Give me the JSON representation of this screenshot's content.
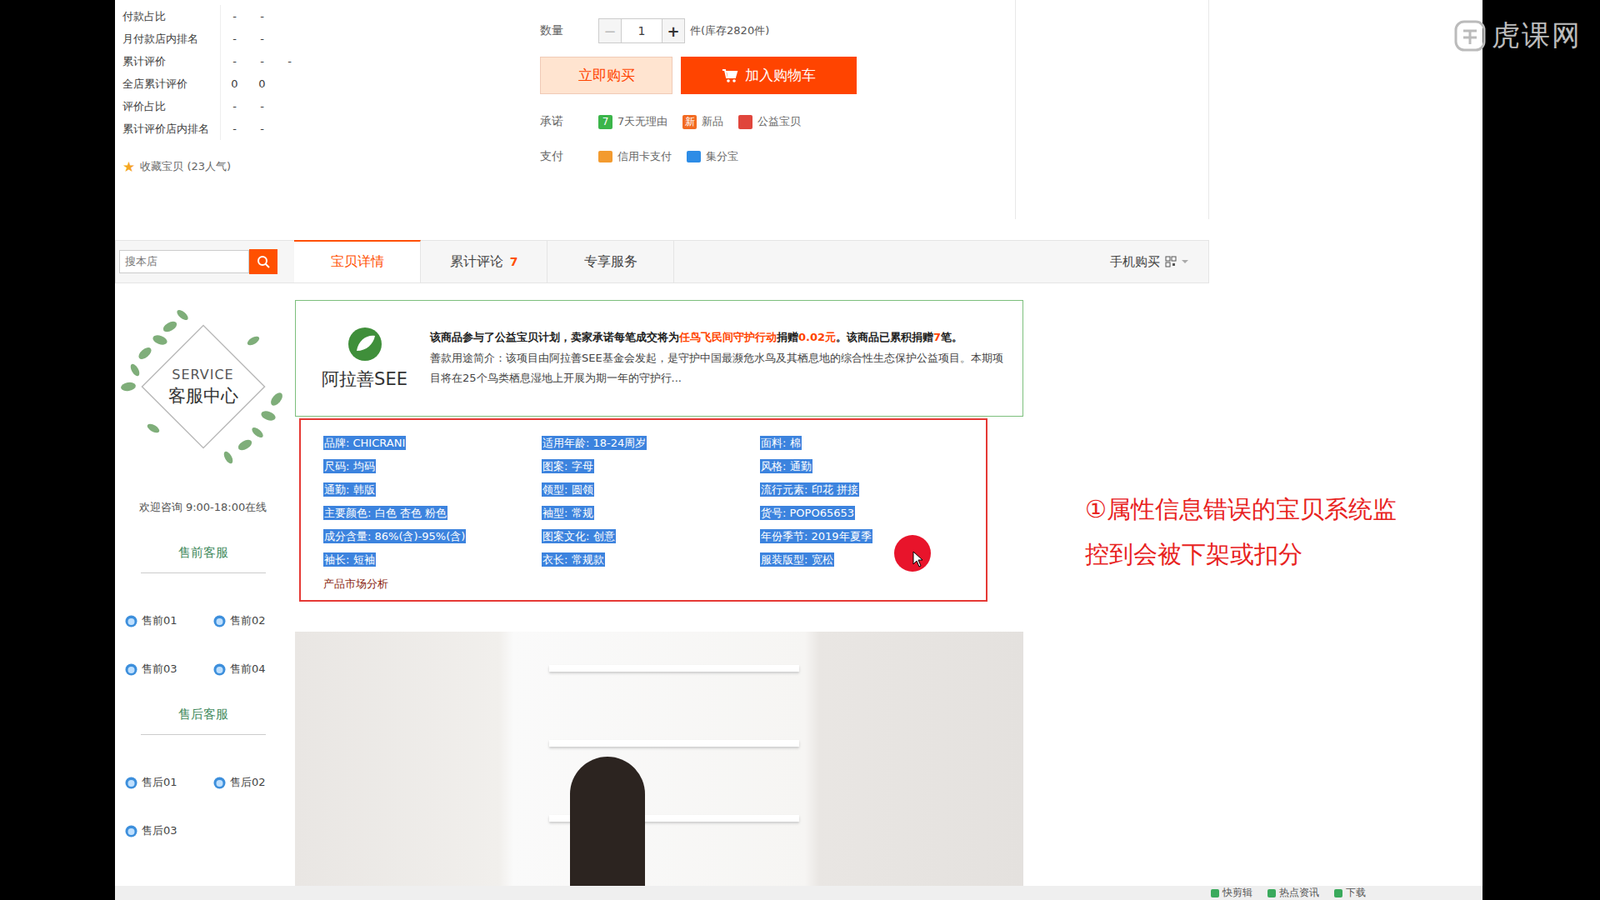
{
  "watermark": {
    "brand": "虎课网"
  },
  "shop_stats": {
    "rows": [
      {
        "label": "付款占比",
        "values": [
          "-",
          "-"
        ]
      },
      {
        "label": "月付款店内排名",
        "values": [
          "-",
          "-"
        ]
      },
      {
        "label": "累计评价",
        "values": [
          "-",
          "-",
          "-"
        ]
      },
      {
        "label": "全店累计评价",
        "values": [
          "0",
          "0"
        ]
      },
      {
        "label": "评价占比",
        "values": [
          "-",
          "-"
        ]
      },
      {
        "label": "累计评价店内排名",
        "values": [
          "-",
          "-"
        ]
      }
    ],
    "favorite": {
      "icon": "★",
      "text": "收藏宝贝 (23人气)"
    }
  },
  "purchase": {
    "quantity_label": "数量",
    "minus": "−",
    "quantity": "1",
    "plus": "+",
    "stock": "件(库存2820件)",
    "buy_now": "立即购买",
    "add_to_cart": "加入购物车",
    "promise": {
      "label": "承诺",
      "items": [
        {
          "badge": "7",
          "text": "7天无理由",
          "color": "#3bb54a"
        },
        {
          "badge": "新",
          "text": "新品",
          "color": "#f26a21"
        },
        {
          "badge": "",
          "text": "公益宝贝",
          "color": "#e0463c"
        }
      ]
    },
    "payment": {
      "label": "支付",
      "items": [
        {
          "text": "信用卡支付",
          "color": "#f39b2f"
        },
        {
          "text": "集分宝",
          "color": "#2d8ce6"
        }
      ]
    }
  },
  "tabbar": {
    "search_placeholder": "搜本店",
    "tabs": [
      {
        "label": "宝贝详情",
        "count": "",
        "selected": true
      },
      {
        "label": "累计评论",
        "count": "7",
        "selected": false
      },
      {
        "label": "专享服务",
        "count": "",
        "selected": false
      }
    ],
    "mobile": "手机购买"
  },
  "sidebar": {
    "service_en": "SERVICE",
    "service_cn": "客服中心",
    "hours": "欢迎咨询 9:00-18:00在线",
    "groups": [
      {
        "title": "售前客服",
        "agents": [
          "售前01",
          "售前02",
          "售前03",
          "售前04"
        ]
      },
      {
        "title": "售后客服",
        "agents": [
          "售后01",
          "售后02",
          "售后03"
        ]
      }
    ]
  },
  "charity": {
    "logo": "阿拉善SEE",
    "line1": [
      {
        "text": "该商品参与了公益宝贝计划，卖家承诺每笔成交将为",
        "accent": false
      },
      {
        "text": "任鸟飞民间守护行动",
        "accent": true
      },
      {
        "text": "捐赠",
        "accent": false
      },
      {
        "text": "0.02元",
        "accent": true
      },
      {
        "text": "。该商品已累积捐赠",
        "accent": false
      },
      {
        "text": "7",
        "accent": true
      },
      {
        "text": "笔。",
        "accent": false
      }
    ],
    "line2": "善款用途简介：该项目由阿拉善SEE基金会发起，是守护中国最濒危水鸟及其栖息地的综合性生态保护公益项目。本期项目将在25个鸟类栖息湿地上开展为期一年的守护行..."
  },
  "attributes": {
    "items": [
      {
        "text": "品牌: CHICRANI",
        "selected": true
      },
      {
        "text": "适用年龄: 18-24周岁",
        "selected": true
      },
      {
        "text": "面料: 棉",
        "selected": true
      },
      {
        "text": "尺码: 均码",
        "selected": true
      },
      {
        "text": "图案: 字母",
        "selected": true
      },
      {
        "text": "风格: 通勤",
        "selected": true
      },
      {
        "text": "通勤: 韩版",
        "selected": true
      },
      {
        "text": "领型: 圆领",
        "selected": true
      },
      {
        "text": "流行元素: 印花 拼接",
        "selected": true
      },
      {
        "text": "主要颜色: 白色 杏色 粉色",
        "selected": true
      },
      {
        "text": "袖型: 常规",
        "selected": true
      },
      {
        "text": "货号: POPO65653",
        "selected": true
      },
      {
        "text": "成分含量: 86%(含)-95%(含)",
        "selected": true
      },
      {
        "text": "图案文化: 创意",
        "selected": true
      },
      {
        "text": "年份季节: 2019年夏季",
        "selected": true
      },
      {
        "text": "袖长: 短袖",
        "selected": true
      },
      {
        "text": "衣长: 常规款",
        "selected": true
      },
      {
        "text": "服装版型: 宽松",
        "selected": true
      }
    ],
    "market_link": "产品市场分析"
  },
  "annotation": {
    "lines": [
      "①属性信息错误的宝贝系统监",
      "控到会被下架或扣分"
    ]
  },
  "status_bar": {
    "items": [
      "快剪辑",
      "热点资讯",
      "下载"
    ]
  }
}
